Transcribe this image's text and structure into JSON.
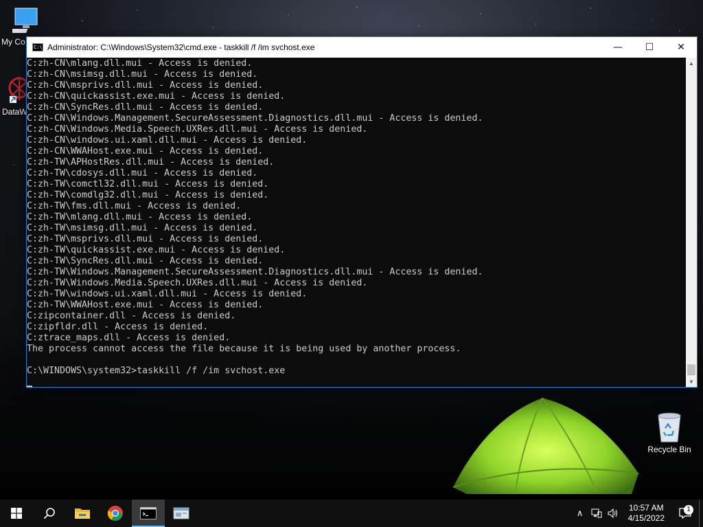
{
  "desktop": {
    "icons": [
      {
        "label": "My Co",
        "icon": "computer-icon"
      },
      {
        "label": "DataW",
        "icon": "datawrangler-icon"
      },
      {
        "label": "Recycle Bin",
        "icon": "recycle-bin-icon"
      }
    ]
  },
  "window": {
    "title": "Administrator: C:\\Windows\\System32\\cmd.exe - taskkill  /f /im svchost.exe",
    "app_icon_text": "C:\\_",
    "minimize_glyph": "—",
    "maximize_glyph": "☐",
    "close_glyph": "✕"
  },
  "console": {
    "lines": [
      "C:zh-CN\\mlang.dll.mui - Access is denied.",
      "C:zh-CN\\msimsg.dll.mui - Access is denied.",
      "C:zh-CN\\msprivs.dll.mui - Access is denied.",
      "C:zh-CN\\quickassist.exe.mui - Access is denied.",
      "C:zh-CN\\SyncRes.dll.mui - Access is denied.",
      "C:zh-CN\\Windows.Management.SecureAssessment.Diagnostics.dll.mui - Access is denied.",
      "C:zh-CN\\Windows.Media.Speech.UXRes.dll.mui - Access is denied.",
      "C:zh-CN\\windows.ui.xaml.dll.mui - Access is denied.",
      "C:zh-CN\\WWAHost.exe.mui - Access is denied.",
      "C:zh-TW\\APHostRes.dll.mui - Access is denied.",
      "C:zh-TW\\cdosys.dll.mui - Access is denied.",
      "C:zh-TW\\comctl32.dll.mui - Access is denied.",
      "C:zh-TW\\comdlg32.dll.mui - Access is denied.",
      "C:zh-TW\\fms.dll.mui - Access is denied.",
      "C:zh-TW\\mlang.dll.mui - Access is denied.",
      "C:zh-TW\\msimsg.dll.mui - Access is denied.",
      "C:zh-TW\\msprivs.dll.mui - Access is denied.",
      "C:zh-TW\\quickassist.exe.mui - Access is denied.",
      "C:zh-TW\\SyncRes.dll.mui - Access is denied.",
      "C:zh-TW\\Windows.Management.SecureAssessment.Diagnostics.dll.mui - Access is denied.",
      "C:zh-TW\\Windows.Media.Speech.UXRes.dll.mui - Access is denied.",
      "C:zh-TW\\windows.ui.xaml.dll.mui - Access is denied.",
      "C:zh-TW\\WWAHost.exe.mui - Access is denied.",
      "C:zipcontainer.dll - Access is denied.",
      "C:zipfldr.dll - Access is denied.",
      "C:ztrace_maps.dll - Access is denied.",
      "The process cannot access the file because it is being used by another process.",
      "",
      "C:\\WINDOWS\\system32>taskkill /f /im svchost.exe"
    ]
  },
  "taskbar": {
    "buttons": [
      {
        "name": "start-button",
        "icon": "windows-logo-icon"
      },
      {
        "name": "search-button",
        "icon": "search-icon"
      },
      {
        "name": "file-explorer-button",
        "icon": "folder-icon"
      },
      {
        "name": "chrome-button",
        "icon": "chrome-icon"
      },
      {
        "name": "cmd-button",
        "icon": "cmd-icon",
        "active": true
      },
      {
        "name": "app-button",
        "icon": "app-window-icon"
      }
    ],
    "tray": {
      "chevron": "∧",
      "time": "10:57 AM",
      "date": "4/15/2022",
      "notification_count": "1"
    }
  },
  "colors": {
    "console_bg": "#0c0c0c",
    "console_text": "#cccccc",
    "accent": "#1883d7"
  }
}
